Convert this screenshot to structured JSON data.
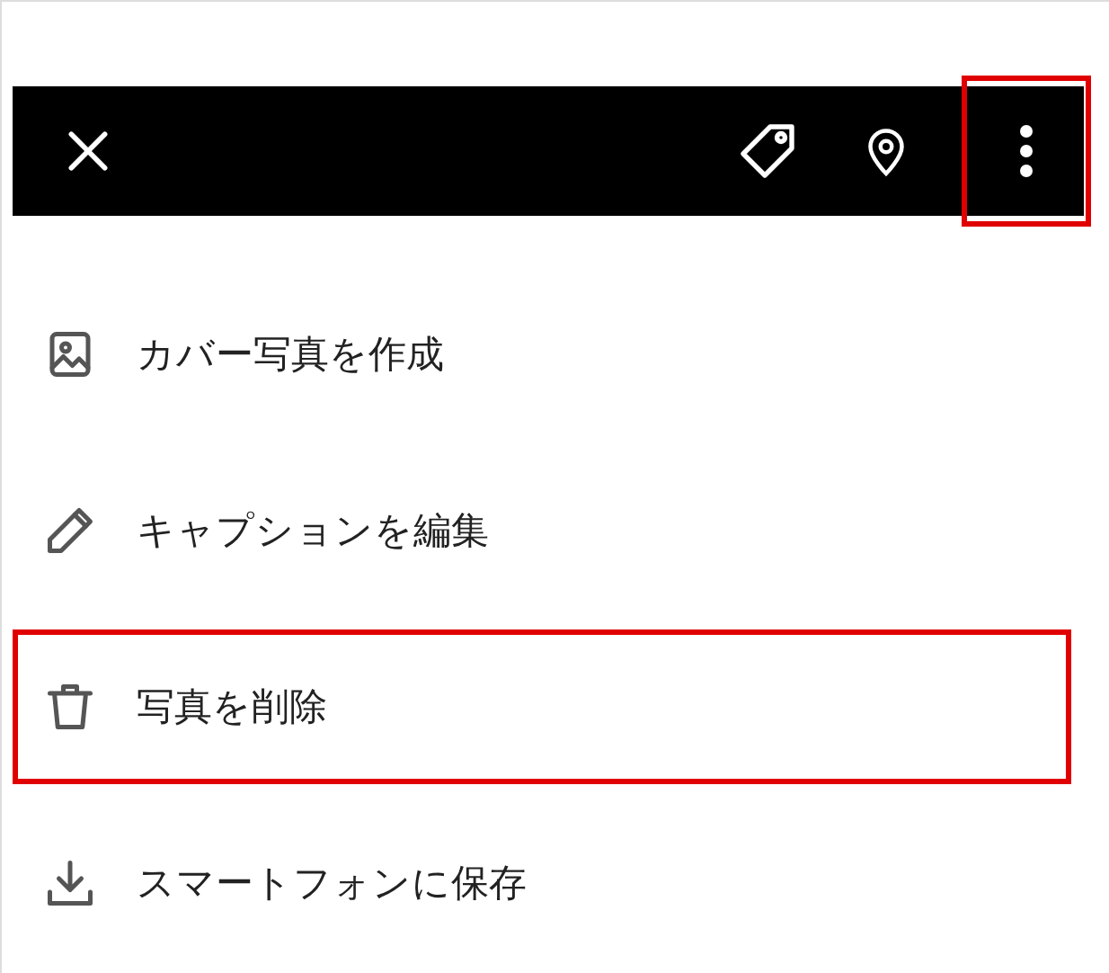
{
  "toolbar": {
    "more_highlighted": true
  },
  "menu": [
    {
      "label": "カバー写真を作成",
      "highlighted": false
    },
    {
      "label": "キャプションを編集",
      "highlighted": false
    },
    {
      "label": "写真を削除",
      "highlighted": true
    },
    {
      "label": "スマートフォンに保存",
      "highlighted": false
    }
  ]
}
